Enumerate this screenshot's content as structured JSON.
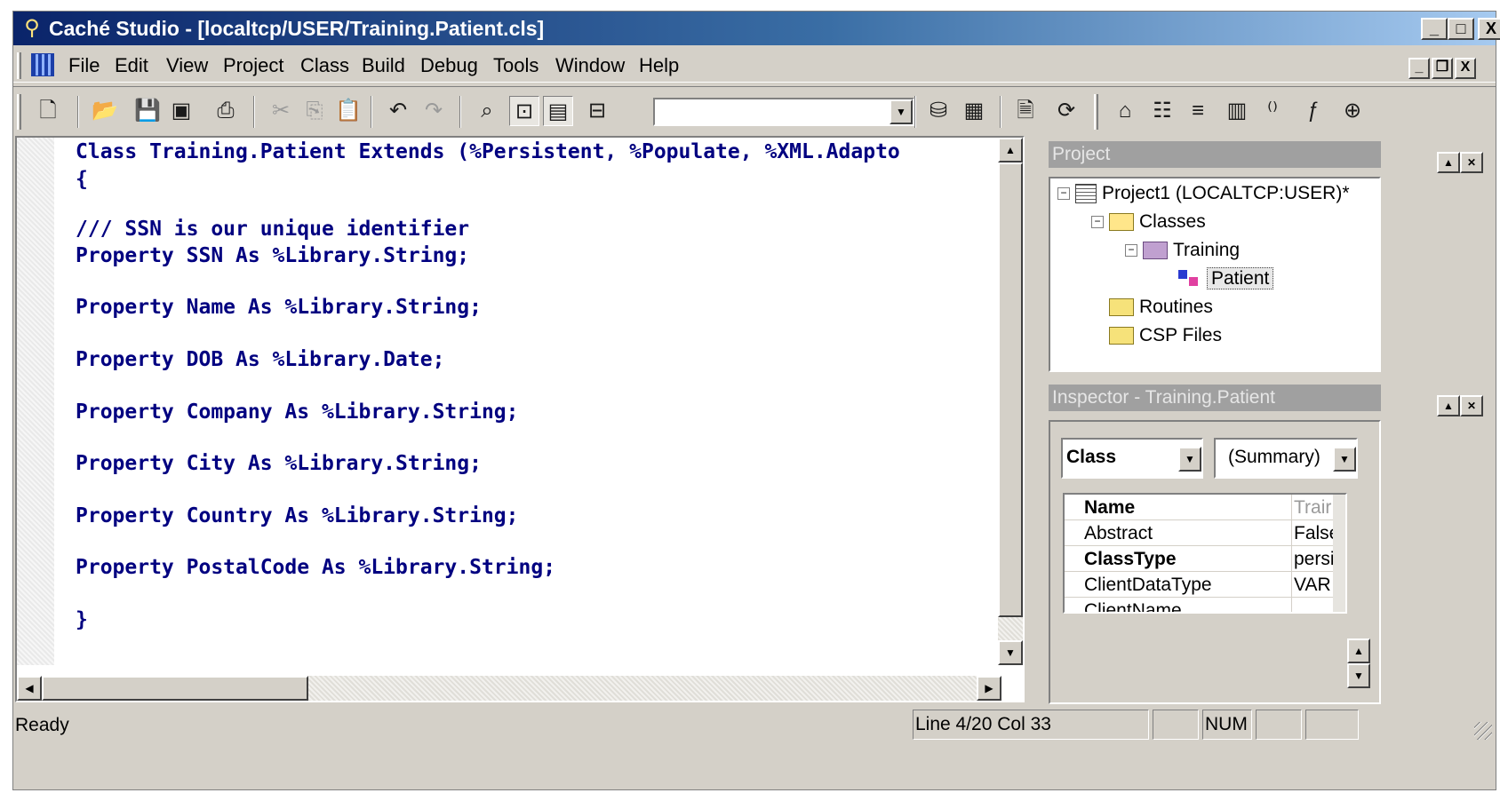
{
  "window": {
    "title": "Caché Studio - [localtcp/USER/Training.Patient.cls]",
    "controls": {
      "minimize": "_",
      "maximize": "□",
      "close": "X"
    },
    "icon": "compass-icon"
  },
  "menu": {
    "items": [
      "File",
      "Edit",
      "View",
      "Project",
      "Class",
      "Build",
      "Debug",
      "Tools",
      "Window",
      "Help"
    ],
    "mdi_controls": {
      "minimize": "_",
      "restore": "❐",
      "close": "X"
    }
  },
  "toolbar": {
    "buttons": [
      "new-file-icon",
      "open-file-icon",
      "save-icon",
      "save-all-icon",
      "print-icon",
      "cut-icon",
      "copy-icon",
      "paste-icon",
      "undo-icon",
      "redo-icon",
      "find-icon",
      "find-in-files-icon",
      "bookmark-icon",
      "goto-icon",
      "compile-icon",
      "build-icon",
      "view-others-icon",
      "refresh-icon",
      "home-icon",
      "class-icon",
      "property-icon",
      "table-icon",
      "parameter-icon",
      "method-icon",
      "add-icon"
    ],
    "combo_value": ""
  },
  "editor": {
    "lines": [
      "Class Training.Patient Extends (%Persistent, %Populate, %XML.Adapto",
      "{",
      "",
      "/// SSN is our unique identifier",
      "Property SSN As %Library.String;",
      "",
      "Property Name As %Library.String;",
      "",
      "Property DOB As %Library.Date;",
      "",
      "Property Company As %Library.String;",
      "",
      "Property City As %Library.String;",
      "",
      "Property Country As %Library.String;",
      "",
      "Property PostalCode As %Library.String;",
      "",
      "}"
    ]
  },
  "project_panel": {
    "title": "Project",
    "tree": {
      "root": "Project1  (LOCALTCP:USER)*",
      "classes": "Classes",
      "package": "Training",
      "class": "Patient",
      "routines": "Routines",
      "csp_files": "CSP Files"
    }
  },
  "inspector": {
    "title": "Inspector - Training.Patient",
    "type_select": "Class",
    "view_select": "(Summary)",
    "rows": [
      {
        "name": "Name",
        "value": "Trair",
        "bold": true,
        "dim": true
      },
      {
        "name": "Abstract",
        "value": "False",
        "bold": false,
        "dim": false
      },
      {
        "name": "ClassType",
        "value": "persi",
        "bold": true,
        "dim": false
      },
      {
        "name": "ClientDataType",
        "value": "VAR",
        "bold": false,
        "dim": false
      },
      {
        "name": "ClientName",
        "value": "",
        "bold": false,
        "dim": false
      }
    ]
  },
  "status": {
    "text": "Ready",
    "position": "Line 4/20 Col 33",
    "num": "NUM",
    "caps": "",
    "ovr": ""
  }
}
